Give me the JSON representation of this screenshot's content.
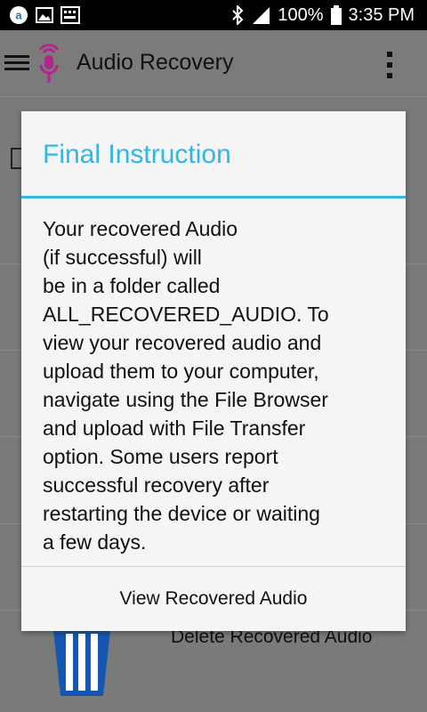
{
  "status_bar": {
    "battery": "100%",
    "time": "3:35 PM",
    "icons": [
      "amazon-icon",
      "image-icon",
      "keyboard-icon",
      "bluetooth-icon",
      "signal-icon",
      "battery-icon"
    ]
  },
  "app_bar": {
    "title": "Audio Recovery",
    "icons": [
      "menu-icon",
      "microphone-icon",
      "overflow-menu-icon"
    ],
    "logo_color": "#b0268c"
  },
  "background": {
    "delete_label": "Delete Recovered Audio",
    "trash_color": "#1557b0"
  },
  "dialog": {
    "title": "Final Instruction",
    "accent_color": "#33b5e5",
    "message_lines": [
      "Your recovered Audio",
      "(if successful) will",
      "be in a folder called",
      "ALL_RECOVERED_AUDIO. To",
      "view your recovered audio and",
      "upload them to your computer,",
      "navigate using the File Browser",
      "and upload with File Transfer",
      "option. Some users report",
      "successful recovery after",
      "restarting the device or waiting",
      "a few days."
    ],
    "button_label": "View Recovered Audio"
  }
}
